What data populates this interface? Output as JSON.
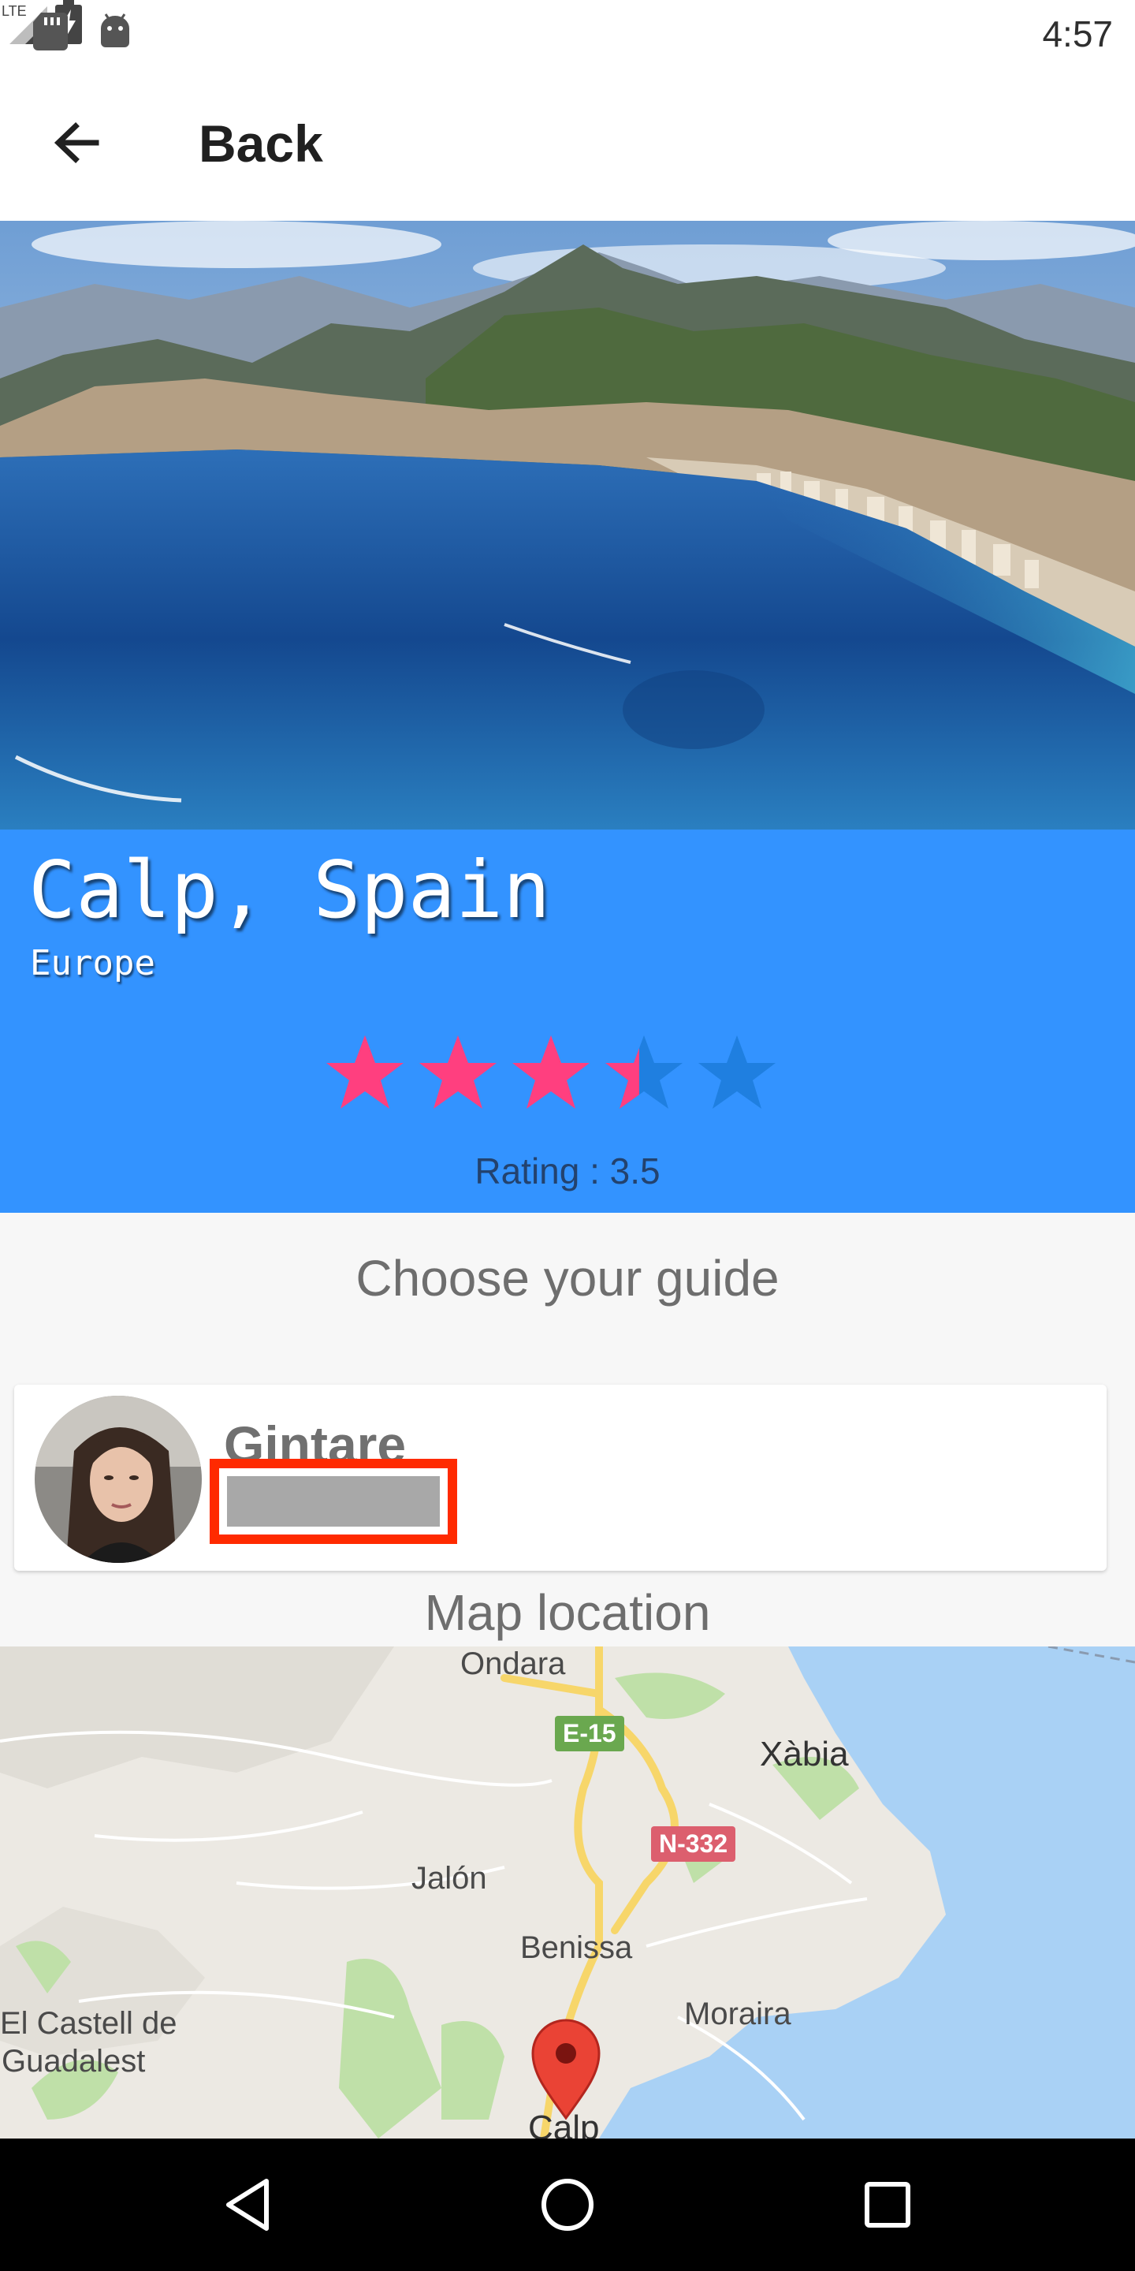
{
  "status_bar": {
    "time": "4:57",
    "network": "LTE",
    "icons": [
      "sd-card-icon",
      "android-icon",
      "signal-icon",
      "battery-charging-icon"
    ]
  },
  "app_bar": {
    "back_icon": "arrow-back-icon",
    "back_label": "Back"
  },
  "destination": {
    "title": "Calp, Spain",
    "continent": "Europe",
    "rating_value": 3.5,
    "rating_max": 5,
    "rating_text": "Rating : 3.5"
  },
  "guide": {
    "heading": "Choose your guide",
    "name": "Gintare"
  },
  "map": {
    "heading": "Map location",
    "labels": {
      "ondara": "Ondara",
      "xabia": "Xàbia",
      "jalon": "Jalón",
      "benissa": "Benissa",
      "moraira": "Moraira",
      "castell1": "El Castell de",
      "castell2": "Guadalest",
      "calp": "Calp"
    },
    "roads": {
      "e15": "E-15",
      "n332": "N-332"
    }
  },
  "nav_bar": {
    "icons": [
      "nav-back-icon",
      "nav-home-icon",
      "nav-recents-icon"
    ]
  },
  "colors": {
    "accent_blue": "#3393ff",
    "star_filled": "#ff3f7f",
    "star_empty": "#1f7fe0",
    "highlight_red": "#ff2a00"
  }
}
